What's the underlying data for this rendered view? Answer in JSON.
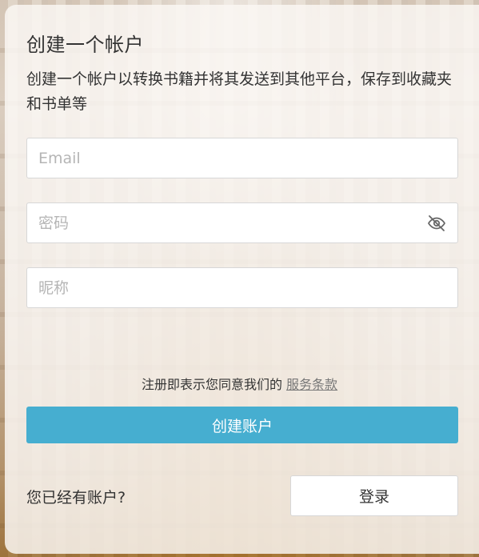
{
  "header": {
    "title": "创建一个帐户",
    "subtitle": "创建一个帐户以转换书籍并将其发送到其他平台，保存到收藏夹和书单等"
  },
  "form": {
    "email_placeholder": "Email",
    "password_placeholder": "密码",
    "nickname_placeholder": "昵称",
    "password_toggle_icon": "eye-off-icon"
  },
  "terms": {
    "prefix": "注册即表示您同意我们的",
    "link_label": "服务条款"
  },
  "actions": {
    "create_label": "创建账户",
    "have_account_label": "您已经有账户?",
    "login_label": "登录"
  },
  "colors": {
    "accent": "#46aed0",
    "text": "#333333",
    "placeholder": "#b5b5b5"
  }
}
